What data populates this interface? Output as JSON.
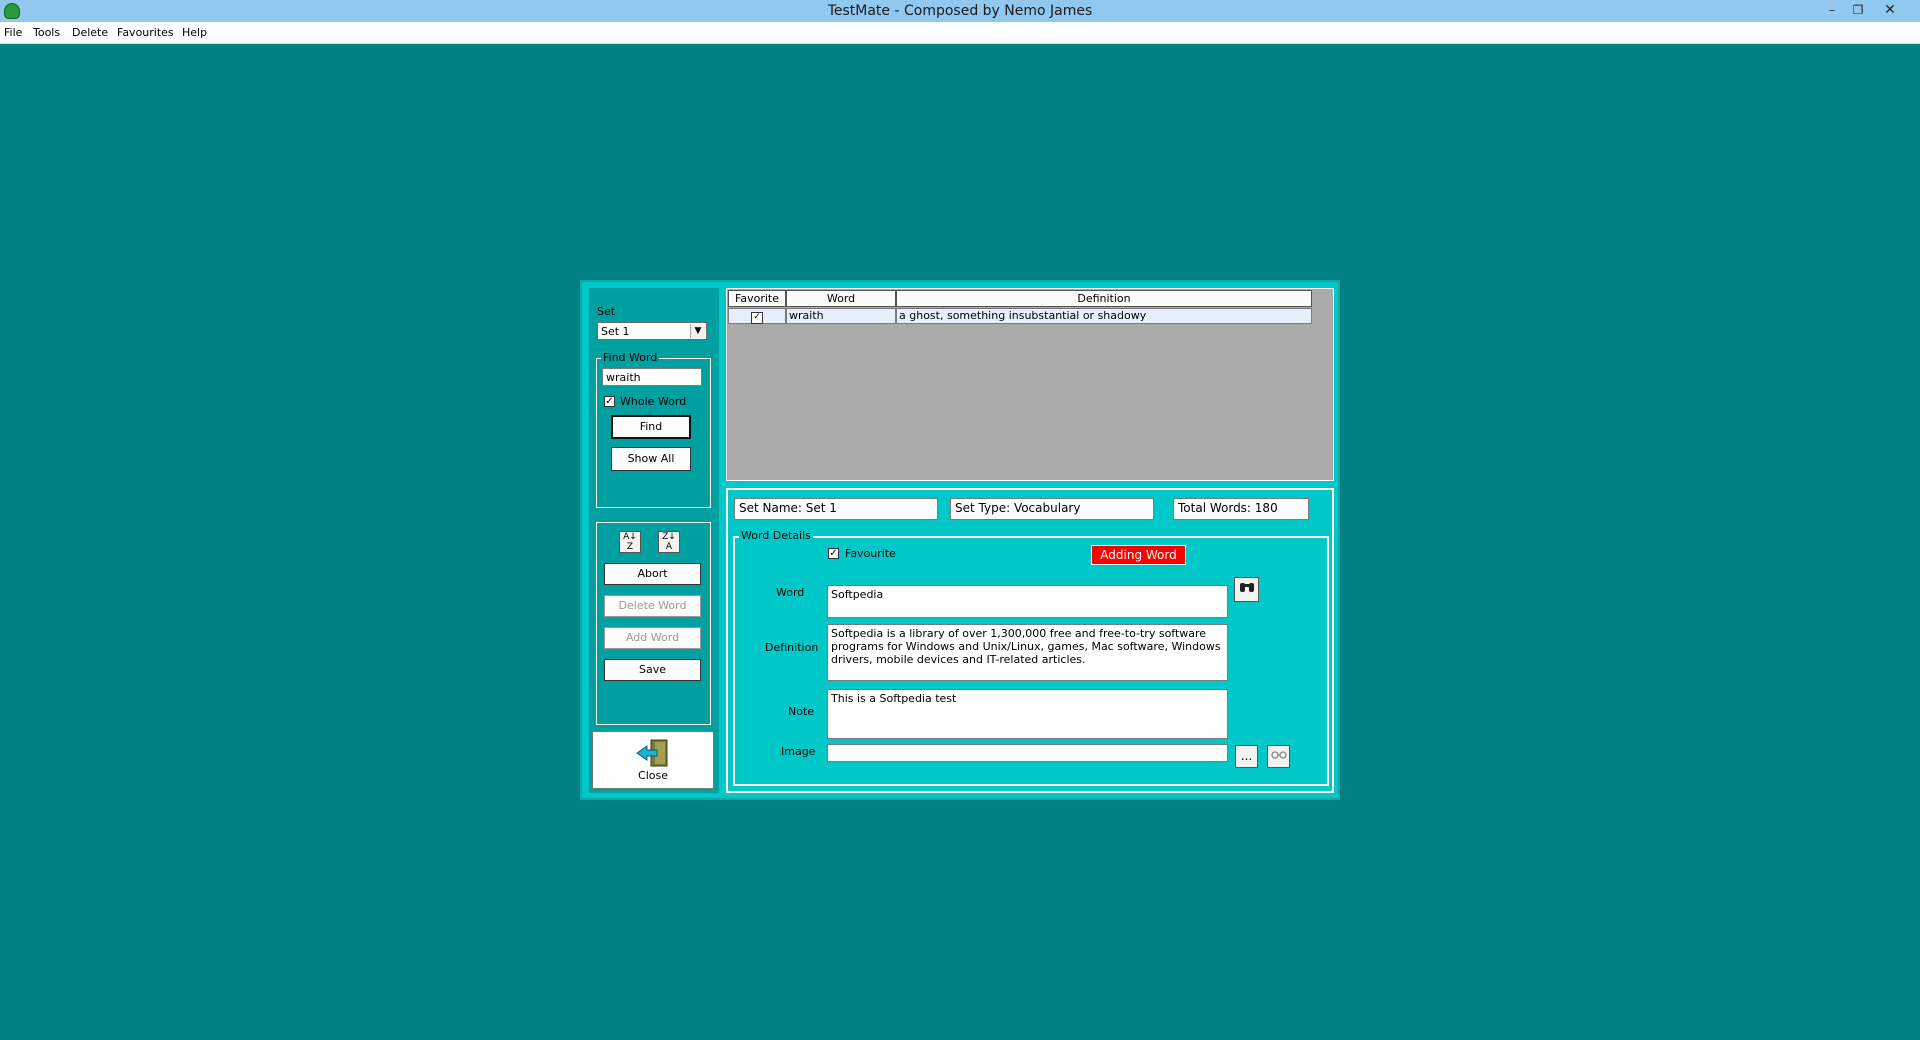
{
  "window": {
    "title": "TestMate - Composed by Nemo James"
  },
  "menu": [
    "File",
    "Tools",
    "Delete",
    "Favourites",
    "Help"
  ],
  "left_panel": {
    "set_label": "Set",
    "set_value": "Set 1",
    "find_word_title": "Find Word",
    "find_value": "wraith",
    "whole_word_label": "Whole Word",
    "whole_word_checked": true,
    "find_button": "Find",
    "show_all_button": "Show All",
    "sort_asc_icon": "sort-az-icon",
    "sort_desc_icon": "sort-za-icon",
    "abort_button": "Abort",
    "delete_word_button": "Delete Word",
    "add_word_button": "Add Word",
    "save_button": "Save",
    "close_button": "Close"
  },
  "grid": {
    "columns": [
      "Favorite",
      "Word",
      "Definition"
    ],
    "rows": [
      {
        "favorite": true,
        "word": "wraith",
        "definition": "a ghost, something insubstantial or shadowy"
      }
    ]
  },
  "details": {
    "set_name": "Set Name: Set 1",
    "set_type": "Set Type: Vocabulary",
    "total_words": "Total Words: 180",
    "word_details_title": "Word Details",
    "favourite_label": "Favourite",
    "favourite_checked": true,
    "status": "Adding Word",
    "status_color": "#ff0000",
    "word_label": "Word",
    "word_value": "Softpedia",
    "definition_label": "Definition",
    "definition_value": "Softpedia is a library of over 1,300,000 free and free-to-try software programs for Windows and Unix/Linux, games, Mac software, Windows drivers, mobile devices and IT-related articles.",
    "note_label": "Note",
    "note_value": "This is a Softpedia test",
    "image_label": "Image",
    "image_value": "",
    "browse_button": "...",
    "view_icon": "glasses-icon",
    "lookup_icon": "binoculars-icon"
  }
}
